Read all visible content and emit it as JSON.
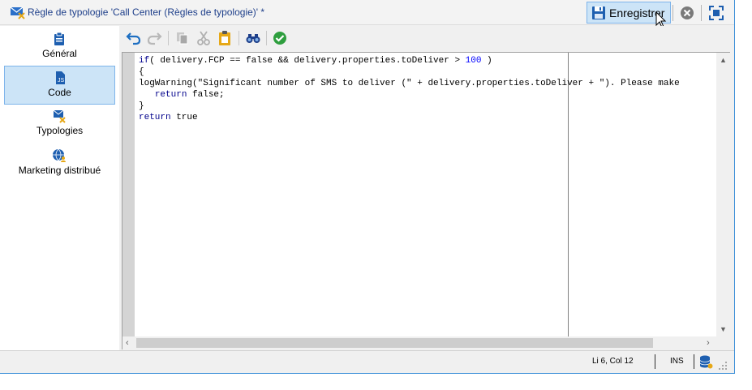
{
  "window": {
    "title": "Règle de typologie 'Call Center (Règles de typologie)' *",
    "save_label": "Enregistrer"
  },
  "sidebar": {
    "items": [
      {
        "label": "Général",
        "icon": "clipboard-icon"
      },
      {
        "label": "Code",
        "icon": "code-file-icon",
        "active": true
      },
      {
        "label": "Typologies",
        "icon": "typology-icon"
      },
      {
        "label": "Marketing distribué",
        "icon": "globe-user-icon"
      }
    ]
  },
  "toolbar": {
    "buttons": [
      "undo-icon",
      "redo-icon",
      "copy-icon",
      "cut-icon",
      "paste-icon",
      "find-icon",
      "validate-icon"
    ]
  },
  "editor": {
    "lines": [
      "if( delivery.FCP == false && delivery.properties.toDeliver > 100 )",
      "{",
      "logWarning(\"Significant number of SMS to deliver (\" + delivery.properties.toDeliver + \"). Please make",
      "   return false;",
      "}",
      "return true"
    ]
  },
  "status": {
    "position": "Li 6, Col 12",
    "mode": "INS"
  },
  "colors": {
    "accent": "#cce4f7",
    "accent_border": "#7eb4ea",
    "keyword": "#00008b",
    "number": "#0000ff",
    "valid_green": "#2e9e3e",
    "paste_yellow": "#e6a817",
    "undo_blue": "#1e6fc2"
  }
}
